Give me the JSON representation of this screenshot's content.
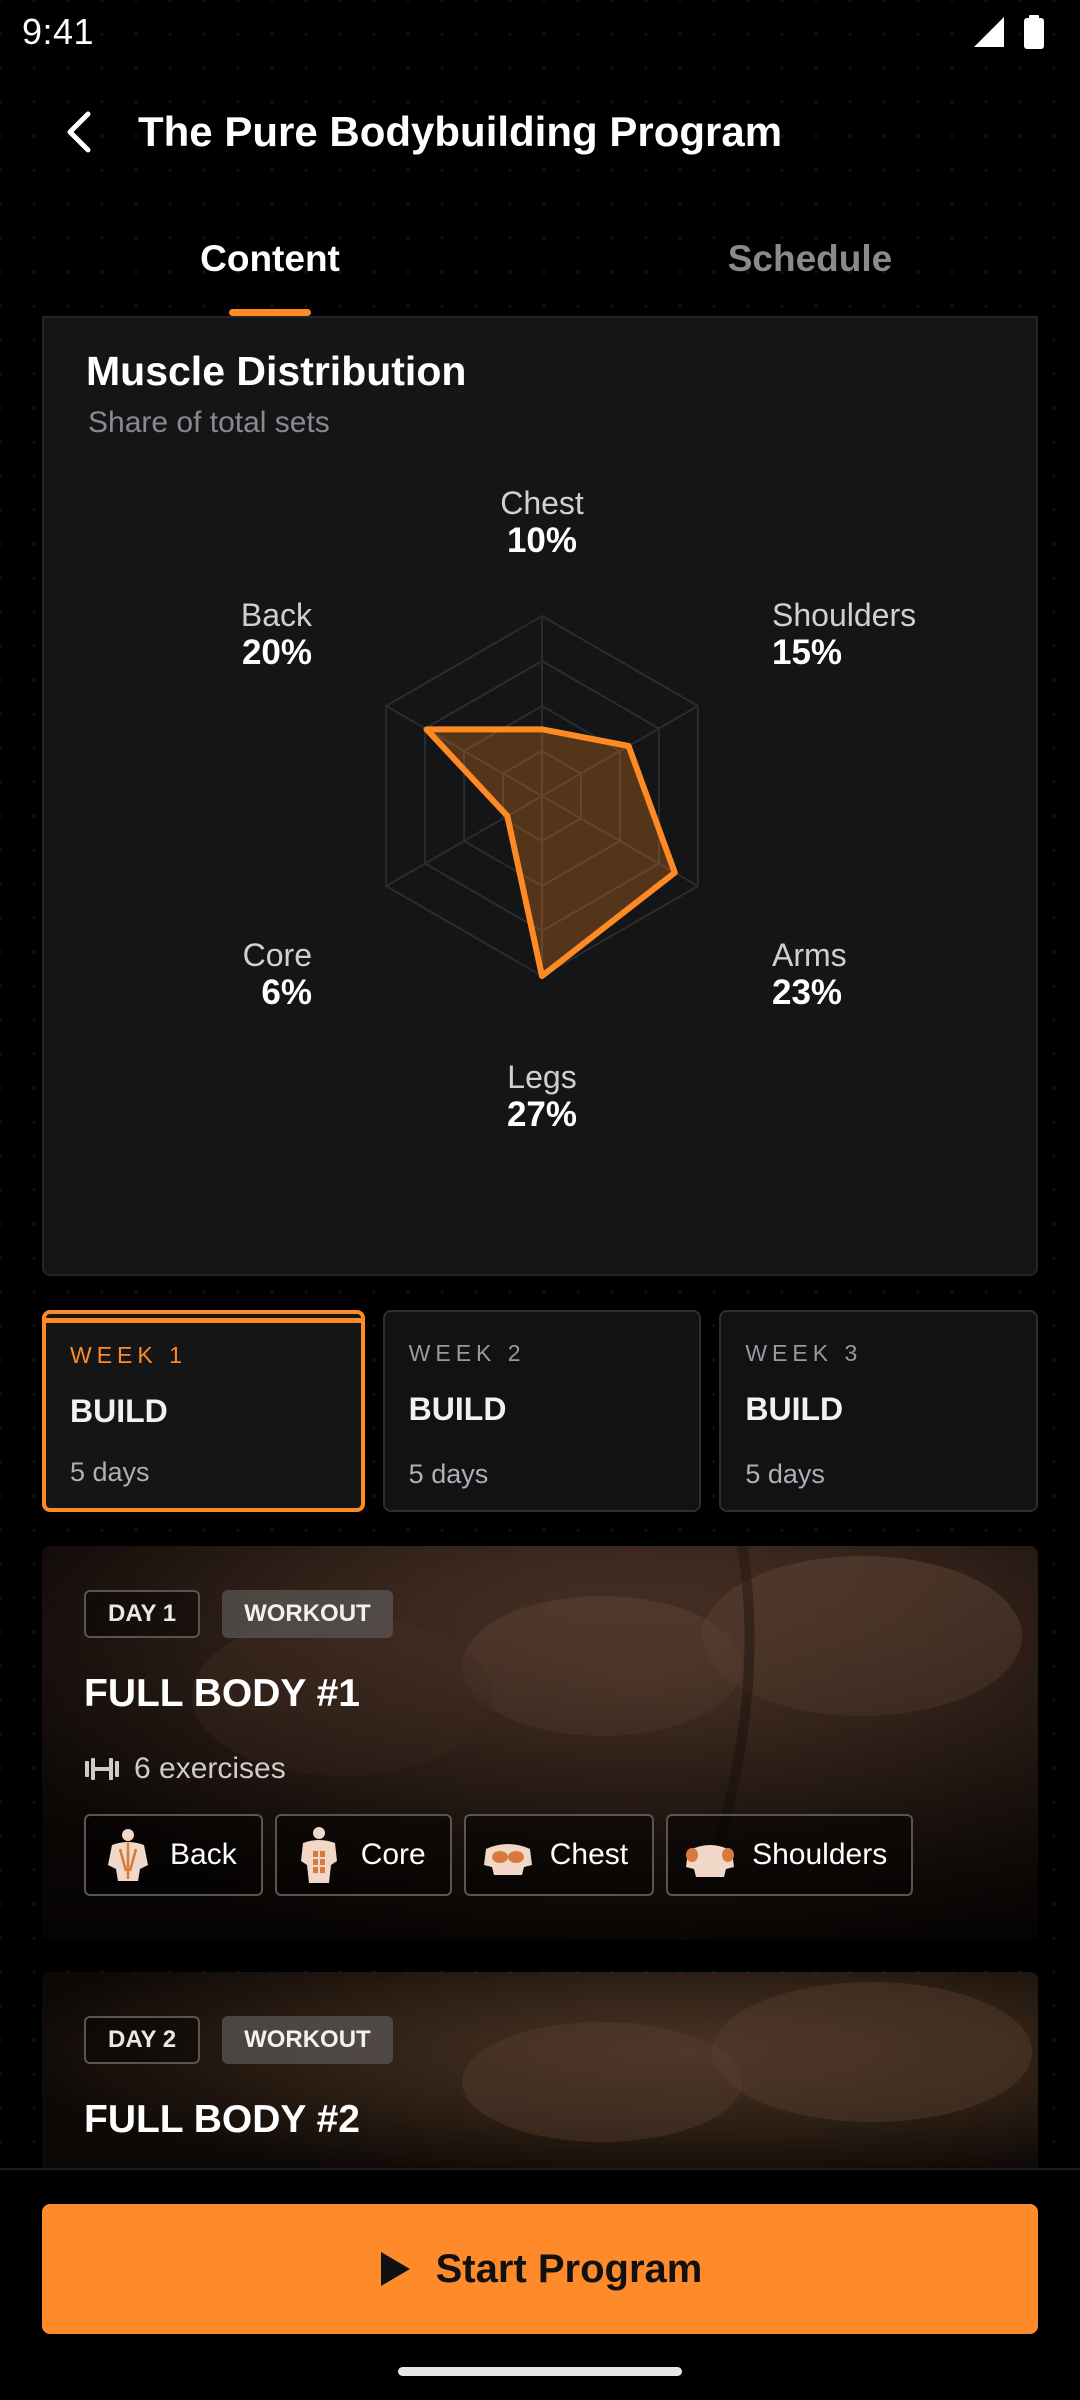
{
  "status_bar": {
    "time": "9:41"
  },
  "header": {
    "title": "The Pure Bodybuilding Program"
  },
  "tabs": [
    {
      "label": "Content",
      "active": true
    },
    {
      "label": "Schedule",
      "active": false
    }
  ],
  "chart": {
    "title": "Muscle Distribution",
    "subtitle": "Share of total sets"
  },
  "chart_data": {
    "type": "radar",
    "title": "Muscle Distribution",
    "subtitle": "Share of total sets",
    "categories": [
      "Chest",
      "Shoulders",
      "Arms",
      "Legs",
      "Core",
      "Back"
    ],
    "values": [
      10,
      15,
      23,
      27,
      6,
      20
    ],
    "value_labels": [
      "10%",
      "15%",
      "23%",
      "27%",
      "6%",
      "20%"
    ],
    "max": 27,
    "grid_rings": 4,
    "colors": {
      "line": "#ff8a24",
      "fill": "#ff8a24"
    }
  },
  "weeks": [
    {
      "label": "WEEK 1",
      "phase": "BUILD",
      "days": "5 days",
      "selected": true
    },
    {
      "label": "WEEK 2",
      "phase": "BUILD",
      "days": "5 days",
      "selected": false
    },
    {
      "label": "WEEK 3",
      "phase": "BUILD",
      "days": "5 days",
      "selected": false
    }
  ],
  "days": [
    {
      "day": "DAY 1",
      "type": "WORKOUT",
      "title": "FULL BODY #1",
      "exercises": "6 exercises",
      "muscles": [
        "Back",
        "Core",
        "Chest",
        "Shoulders"
      ]
    },
    {
      "day": "DAY 2",
      "type": "WORKOUT",
      "title": "FULL BODY #2"
    }
  ],
  "cta": {
    "label": "Start Program"
  },
  "colors": {
    "accent": "#ff8a24",
    "card_bg": "#141517"
  },
  "icons": [
    "back-arrow-icon",
    "signal-icon",
    "battery-icon",
    "dumbbell-icon",
    "play-icon"
  ]
}
